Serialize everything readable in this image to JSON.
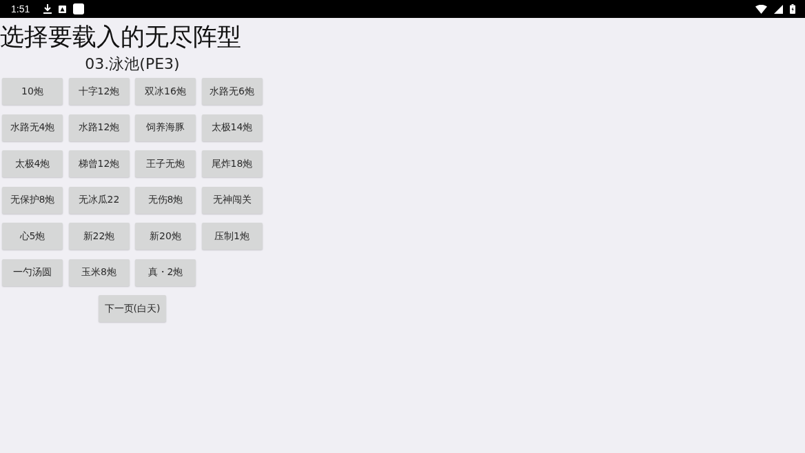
{
  "status_bar": {
    "time": "1:51"
  },
  "title": "选择要载入的无尽阵型",
  "subtitle": "03.泳池(PE3)",
  "layout_buttons": [
    {
      "label": "10炮"
    },
    {
      "label": "十字12炮"
    },
    {
      "label": "双冰16炮"
    },
    {
      "label": "水路无6炮"
    },
    {
      "label": "水路无4炮"
    },
    {
      "label": "水路12炮"
    },
    {
      "label": "饲养海豚"
    },
    {
      "label": "太极14炮"
    },
    {
      "label": "太极4炮"
    },
    {
      "label": "梯曾12炮"
    },
    {
      "label": "王子无炮"
    },
    {
      "label": "尾炸18炮"
    },
    {
      "label": "无保护8炮"
    },
    {
      "label": "无冰瓜22"
    },
    {
      "label": "无伤8炮"
    },
    {
      "label": "无神闯关"
    },
    {
      "label": "心5炮"
    },
    {
      "label": "新22炮"
    },
    {
      "label": "新20炮"
    },
    {
      "label": "压制1炮"
    },
    {
      "label": "一勺汤圆"
    },
    {
      "label": "玉米8炮"
    },
    {
      "label": "真・2炮"
    }
  ],
  "next_button": {
    "label": "下一页(白天)"
  }
}
